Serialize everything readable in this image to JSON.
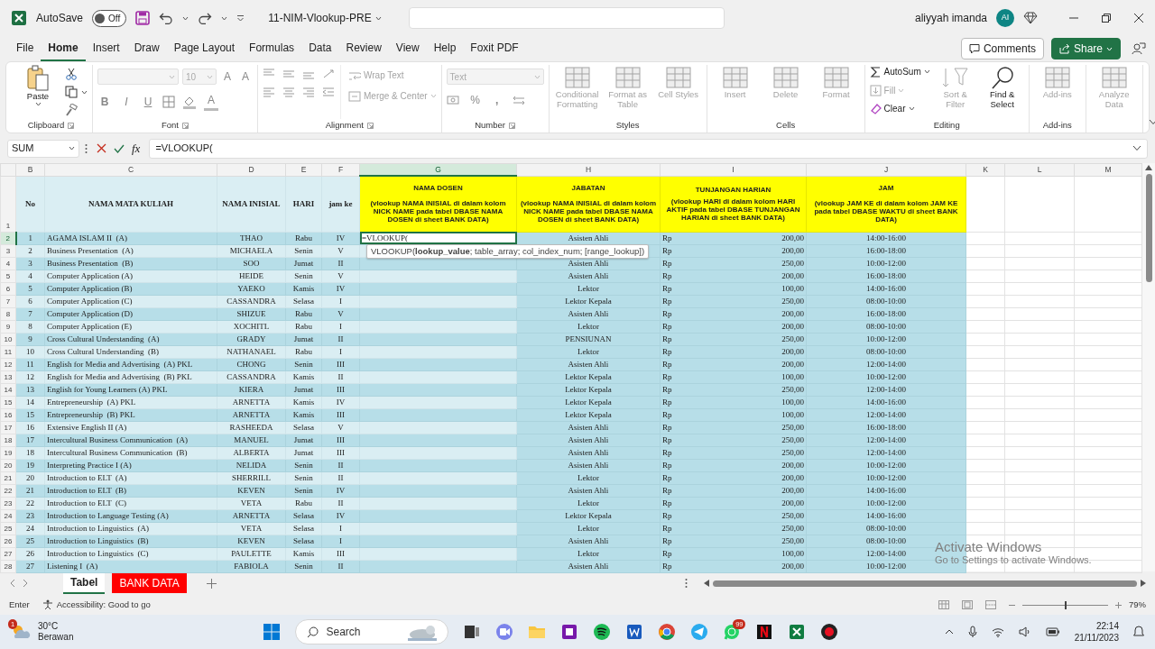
{
  "title_bar": {
    "autosave_label": "AutoSave",
    "autosave": {
      "on": false,
      "label": "Off"
    },
    "file_name": "11-NIM-Vlookup-PRE",
    "user_name": "aliyyah imanda",
    "user_initials": "AI"
  },
  "ribbon_tabs": [
    {
      "label": "File",
      "selected": false
    },
    {
      "label": "Home",
      "selected": true
    },
    {
      "label": "Insert",
      "selected": false
    },
    {
      "label": "Draw",
      "selected": false
    },
    {
      "label": "Page Layout",
      "selected": false
    },
    {
      "label": "Formulas",
      "selected": false
    },
    {
      "label": "Data",
      "selected": false
    },
    {
      "label": "Review",
      "selected": false
    },
    {
      "label": "View",
      "selected": false
    },
    {
      "label": "Help",
      "selected": false
    },
    {
      "label": "Foxit PDF",
      "selected": false
    }
  ],
  "comments_button": "Comments",
  "share_button": "Share",
  "ribbon_groups": [
    {
      "kind": "clipboard",
      "label": "Clipboard",
      "buttons": [
        {
          "label": "Paste",
          "disabled": false
        }
      ]
    },
    {
      "kind": "font",
      "label": "Font",
      "font_size": "10",
      "size_buttons": [
        "A",
        "A"
      ],
      "style_buttons": [
        "B",
        "I",
        "U"
      ],
      "font_color_button": "A"
    },
    {
      "kind": "alignment",
      "label": "Alignment",
      "buttons": [
        {
          "label": "Wrap Text",
          "disabled": true
        },
        {
          "label": "Merge & Center",
          "disabled": true
        }
      ]
    },
    {
      "kind": "number",
      "label": "Number",
      "format": "Text",
      "percent_button": "%",
      "comma_button": ","
    },
    {
      "kind": "large",
      "label": "Styles",
      "buttons": [
        {
          "label": "Conditional Formatting",
          "disabled": true
        },
        {
          "label": "Format as Table",
          "disabled": true
        },
        {
          "label": "Cell Styles",
          "disabled": true
        }
      ]
    },
    {
      "kind": "large",
      "label": "Cells",
      "buttons": [
        {
          "label": "Insert",
          "disabled": true
        },
        {
          "label": "Delete",
          "disabled": true
        },
        {
          "label": "Format",
          "disabled": true
        }
      ]
    },
    {
      "kind": "editing",
      "label": "Editing",
      "buttons": [
        {
          "label": "AutoSum",
          "disabled": false
        },
        {
          "label": "Fill",
          "disabled": true
        },
        {
          "label": "Clear",
          "disabled": false
        },
        {
          "label": "Sort & Filter",
          "disabled": true
        },
        {
          "label": "Find & Select",
          "disabled": false
        }
      ]
    },
    {
      "kind": "large",
      "label": "Add-ins",
      "buttons": [
        {
          "label": "Add-ins",
          "disabled": true
        }
      ]
    },
    {
      "kind": "large",
      "buttons": [
        {
          "label": "Analyze Data",
          "disabled": true
        }
      ]
    }
  ],
  "formula_bar": {
    "name_box": "SUM",
    "function_button": "fx",
    "formula": "=VLOOKUP("
  },
  "sheet": {
    "columns": [
      {
        "letter": "B",
        "selected": false
      },
      {
        "letter": "C",
        "selected": false
      },
      {
        "letter": "D",
        "selected": false
      },
      {
        "letter": "E",
        "selected": false
      },
      {
        "letter": "F",
        "selected": false
      },
      {
        "letter": "G",
        "selected": true
      },
      {
        "letter": "H",
        "selected": false
      },
      {
        "letter": "I",
        "selected": false
      },
      {
        "letter": "J",
        "selected": false
      },
      {
        "letter": "K",
        "selected": false
      },
      {
        "letter": "L",
        "selected": false
      },
      {
        "letter": "M",
        "selected": false
      }
    ],
    "header_row": {
      "row_number": "1",
      "no": "No",
      "course": "NAMA MATA KULIAH",
      "initial": "NAMA INISIAL",
      "day": "HARI",
      "hour": "jam ke",
      "lookups": [
        {
          "title": "NAMA DOSEN",
          "note": "(vlookup NAMA INISIAL di dalam kolom NICK NAME pada tabel DBASE NAMA DOSEN di sheet BANK DATA)"
        },
        {
          "title": "JABATAN",
          "note": "(vlookup NAMA INISIAL di dalam kolom NICK NAME pada tabel DBASE NAMA DOSEN di sheet BANK DATA)"
        },
        {
          "title": "TUNJANGAN HARIAN",
          "note": "(vlookup HARI di dalam kolom HARI AKTIF pada tabel DBASE TUNJANGAN HARIAN di sheet BANK DATA)"
        },
        {
          "title": "JAM",
          "note": "(vlookup JAM KE di dalam kolom JAM KE pada tabel DBASE WAKTU di sheet BANK DATA)"
        }
      ]
    },
    "rows": [
      {
        "row_number": "2",
        "selected": true,
        "no": "1",
        "course": "AGAMA ISLAM II  (A)",
        "initial": "THAO",
        "day": "Rabu",
        "hour": "IV",
        "lecturer": "=VLOOKUP(",
        "position": "Asisten Ahli",
        "currency": "Rp",
        "allowance": "200,00",
        "time": "14:00-16:00"
      },
      {
        "row_number": "3",
        "selected": false,
        "no": "2",
        "course": "Business Presentation  (A)",
        "initial": "MICHAELA",
        "day": "Senin",
        "hour": "V",
        "currency": "Rp",
        "allowance": "200,00",
        "time": "16:00-18:00"
      },
      {
        "row_number": "4",
        "selected": false,
        "no": "3",
        "course": "Business Presentation  (B)",
        "initial": "SOO",
        "day": "Jumat",
        "hour": "II",
        "position": "Asisten Ahli",
        "currency": "Rp",
        "allowance": "250,00",
        "time": "10:00-12:00"
      },
      {
        "row_number": "5",
        "selected": false,
        "no": "4",
        "course": "Computer Application (A)",
        "initial": "HEIDE",
        "day": "Senin",
        "hour": "V",
        "position": "Asisten Ahli",
        "currency": "Rp",
        "allowance": "200,00",
        "time": "16:00-18:00"
      },
      {
        "row_number": "6",
        "selected": false,
        "no": "5",
        "course": "Computer Application (B)",
        "initial": "YAEKO",
        "day": "Kamis",
        "hour": "IV",
        "position": "Lektor",
        "currency": "Rp",
        "allowance": "100,00",
        "time": "14:00-16:00"
      },
      {
        "row_number": "7",
        "selected": false,
        "no": "6",
        "course": "Computer Application (C)",
        "initial": "CASSANDRA",
        "day": "Selasa",
        "hour": "I",
        "position": "Lektor Kepala",
        "currency": "Rp",
        "allowance": "250,00",
        "time": "08:00-10:00"
      },
      {
        "row_number": "8",
        "selected": false,
        "no": "7",
        "course": "Computer Application (D)",
        "initial": "SHIZUE",
        "day": "Rabu",
        "hour": "V",
        "position": "Asisten Ahli",
        "currency": "Rp",
        "allowance": "200,00",
        "time": "16:00-18:00"
      },
      {
        "row_number": "9",
        "selected": false,
        "no": "8",
        "course": "Computer Application (E)",
        "initial": "XOCHITL",
        "day": "Rabu",
        "hour": "I",
        "position": "Lektor",
        "currency": "Rp",
        "allowance": "200,00",
        "time": "08:00-10:00"
      },
      {
        "row_number": "10",
        "selected": false,
        "no": "9",
        "course": "Cross Cultural Understanding  (A)",
        "initial": "GRADY",
        "day": "Jumat",
        "hour": "II",
        "position": "PENSIUNAN",
        "currency": "Rp",
        "allowance": "250,00",
        "time": "10:00-12:00"
      },
      {
        "row_number": "11",
        "selected": false,
        "no": "10",
        "course": "Cross Cultural Understanding  (B)",
        "initial": "NATHANAEL",
        "day": "Rabu",
        "hour": "I",
        "position": "Lektor",
        "currency": "Rp",
        "allowance": "200,00",
        "time": "08:00-10:00"
      },
      {
        "row_number": "12",
        "selected": false,
        "no": "11",
        "course": "English for Media and Advertising  (A) PKL",
        "initial": "CHONG",
        "day": "Senin",
        "hour": "III",
        "position": "Asisten Ahli",
        "currency": "Rp",
        "allowance": "200,00",
        "time": "12:00-14:00"
      },
      {
        "row_number": "13",
        "selected": false,
        "no": "12",
        "course": "English for Media and Advertising  (B) PKL",
        "initial": "CASSANDRA",
        "day": "Kamis",
        "hour": "II",
        "position": "Lektor Kepala",
        "currency": "Rp",
        "allowance": "100,00",
        "time": "10:00-12:00"
      },
      {
        "row_number": "14",
        "selected": false,
        "no": "13",
        "course": "English for Young Learners (A) PKL",
        "initial": "KIERA",
        "day": "Jumat",
        "hour": "III",
        "position": "Lektor Kepala",
        "currency": "Rp",
        "allowance": "250,00",
        "time": "12:00-14:00"
      },
      {
        "row_number": "15",
        "selected": false,
        "no": "14",
        "course": "Entrepreneurship  (A) PKL",
        "initial": "ARNETTA",
        "day": "Kamis",
        "hour": "IV",
        "position": "Lektor Kepala",
        "currency": "Rp",
        "allowance": "100,00",
        "time": "14:00-16:00"
      },
      {
        "row_number": "16",
        "selected": false,
        "no": "15",
        "course": "Entrepreneurship  (B) PKL",
        "initial": "ARNETTA",
        "day": "Kamis",
        "hour": "III",
        "position": "Lektor Kepala",
        "currency": "Rp",
        "allowance": "100,00",
        "time": "12:00-14:00"
      },
      {
        "row_number": "17",
        "selected": false,
        "no": "16",
        "course": "Extensive English II (A)",
        "initial": "RASHEEDA",
        "day": "Selasa",
        "hour": "V",
        "position": "Asisten Ahli",
        "currency": "Rp",
        "allowance": "250,00",
        "time": "16:00-18:00"
      },
      {
        "row_number": "18",
        "selected": false,
        "no": "17",
        "course": "Intercultural Business Communication  (A)",
        "initial": "MANUEL",
        "day": "Jumat",
        "hour": "III",
        "position": "Asisten Ahli",
        "currency": "Rp",
        "allowance": "250,00",
        "time": "12:00-14:00"
      },
      {
        "row_number": "19",
        "selected": false,
        "no": "18",
        "course": "Intercultural Business Communication  (B)",
        "initial": "ALBERTA",
        "day": "Jumat",
        "hour": "III",
        "position": "Asisten Ahli",
        "currency": "Rp",
        "allowance": "250,00",
        "time": "12:00-14:00"
      },
      {
        "row_number": "20",
        "selected": false,
        "no": "19",
        "course": "Interpreting Practice I (A)",
        "initial": "NELIDA",
        "day": "Senin",
        "hour": "II",
        "position": "Asisten Ahli",
        "currency": "Rp",
        "allowance": "200,00",
        "time": "10:00-12:00"
      },
      {
        "row_number": "21",
        "selected": false,
        "no": "20",
        "course": "Introduction to ELT  (A)",
        "initial": "SHERRILL",
        "day": "Senin",
        "hour": "II",
        "position": "Lektor",
        "currency": "Rp",
        "allowance": "200,00",
        "time": "10:00-12:00"
      },
      {
        "row_number": "22",
        "selected": false,
        "no": "21",
        "course": "Introduction to ELT  (B)",
        "initial": "KEVEN",
        "day": "Senin",
        "hour": "IV",
        "position": "Asisten Ahli",
        "currency": "Rp",
        "allowance": "200,00",
        "time": "14:00-16:00"
      },
      {
        "row_number": "23",
        "selected": false,
        "no": "22",
        "course": "Introduction to ELT  (C)",
        "initial": "VETA",
        "day": "Rabu",
        "hour": "II",
        "position": "Lektor",
        "currency": "Rp",
        "allowance": "200,00",
        "time": "10:00-12:00"
      },
      {
        "row_number": "24",
        "selected": false,
        "no": "23",
        "course": "Introduction to Language Testing (A)",
        "initial": "ARNETTA",
        "day": "Selasa",
        "hour": "IV",
        "position": "Lektor Kepala",
        "currency": "Rp",
        "allowance": "250,00",
        "time": "14:00-16:00"
      },
      {
        "row_number": "25",
        "selected": false,
        "no": "24",
        "course": "Introduction to Linguistics  (A)",
        "initial": "VETA",
        "day": "Selasa",
        "hour": "I",
        "position": "Lektor",
        "currency": "Rp",
        "allowance": "250,00",
        "time": "08:00-10:00"
      },
      {
        "row_number": "26",
        "selected": false,
        "no": "25",
        "course": "Introduction to Linguistics  (B)",
        "initial": "KEVEN",
        "day": "Selasa",
        "hour": "I",
        "position": "Asisten Ahli",
        "currency": "Rp",
        "allowance": "250,00",
        "time": "08:00-10:00"
      },
      {
        "row_number": "27",
        "selected": false,
        "no": "26",
        "course": "Introduction to Linguistics  (C)",
        "initial": "PAULETTE",
        "day": "Kamis",
        "hour": "III",
        "position": "Lektor",
        "currency": "Rp",
        "allowance": "100,00",
        "time": "12:00-14:00"
      },
      {
        "row_number": "28",
        "selected": false,
        "no": "27",
        "course": "Listening I  (A)",
        "initial": "FABIOLA",
        "day": "Senin",
        "hour": "II",
        "position": "Asisten Ahli",
        "currency": "Rp",
        "allowance": "200,00",
        "time": "10:00-12:00"
      }
    ]
  },
  "formula_tooltip": "VLOOKUP(**lookup_value**; table_array; col_index_num; [range_lookup])",
  "sheet_tabs": [
    {
      "label": "Tabel",
      "selected": true
    },
    {
      "label": "BANK DATA",
      "selected": false,
      "color": "#ff0000"
    }
  ],
  "status_bar": {
    "mode": "Enter",
    "accessibility": "Accessibility: Good to go",
    "zoom": {
      "level": 0.5,
      "reading": "79%"
    }
  },
  "activation_notice": {
    "title": "Activate Windows",
    "text": "Go to Settings to activate Windows."
  },
  "taskbar": {
    "weather_badge": "1",
    "temperature": "30°C",
    "weather": "Berawan",
    "search": "Search",
    "whatsapp_badge": "99",
    "time": "22:14",
    "date": "21/11/2023"
  }
}
